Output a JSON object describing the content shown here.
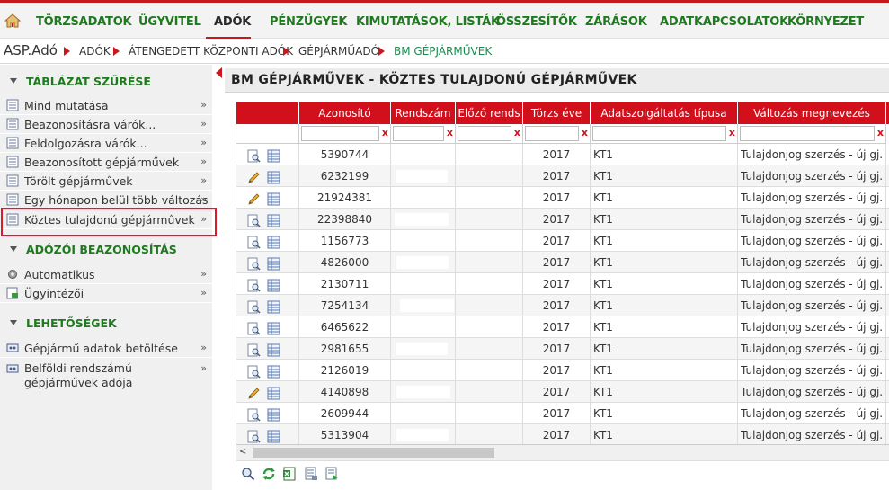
{
  "menu": {
    "home_icon": "home-icon",
    "items": [
      "TÖRZSADATOK",
      "ÜGYVITEL",
      "ADÓK",
      "PÉNZÜGYEK",
      "KIMUTATÁSOK, LISTÁK",
      "ÖSSZESÍTŐK",
      "ZÁRÁSOK",
      "ADATKAPCSOLATOK",
      "KÖRNYEZET"
    ],
    "active": "ADÓK"
  },
  "breadcrumb": [
    "ASP.Adó",
    "Adók",
    "Átengedett központi adók",
    "Gépjárműadó",
    "BM gépjárművek"
  ],
  "sidebar": {
    "filter_title": "TÁBLÁZAT SZŰRÉSE",
    "filter_items": [
      {
        "label": "Mind mutatása"
      },
      {
        "label": "Beazonosításra várók..."
      },
      {
        "label": "Feldolgozásra várók..."
      },
      {
        "label": "Beazonosított gépjárművek"
      },
      {
        "label": "Törölt gépjárművek"
      },
      {
        "label": "Egy hónapon belül több változás"
      },
      {
        "label": "Köztes tulajdonú gépjárművek"
      }
    ],
    "ident_title": "ADÓZÓI BEAZONOSÍTÁS",
    "ident_items": [
      {
        "label": "Automatikus"
      },
      {
        "label": "Ügyintézői"
      }
    ],
    "options_title": "LEHETŐSÉGEK",
    "options_items": [
      {
        "label": "Gépjármű adatok betöltése"
      },
      {
        "label": "Belföldi rendszámú gépjárművek adója"
      }
    ],
    "chevron": "»"
  },
  "main": {
    "title": "BM GÉPJÁRMŰVEK - KÖZTES TULAJDONÚ GÉPJÁRMŰVEK",
    "columns": [
      "Azonosító",
      "Rendszám",
      "Előző rends",
      "Törzs éve",
      "Adatszolgáltatás típusa",
      "Változás megnevezés"
    ],
    "filter_clear": "x",
    "rows": [
      {
        "icon": "view",
        "id": "5390744",
        "year": "2017",
        "type": "KT1",
        "change": "Tulajdonjog szerzés - új gj."
      },
      {
        "icon": "edit",
        "id": "6232199",
        "year": "2017",
        "type": "KT1",
        "change": "Tulajdonjog szerzés - új gj."
      },
      {
        "icon": "edit",
        "id": "21924381",
        "year": "2017",
        "type": "KT1",
        "change": "Tulajdonjog szerzés - új gj."
      },
      {
        "icon": "view",
        "id": "22398840",
        "year": "2017",
        "type": "KT1",
        "change": "Tulajdonjog szerzés - új gj."
      },
      {
        "icon": "view",
        "id": "1156773",
        "year": "2017",
        "type": "KT1",
        "change": "Tulajdonjog szerzés - új gj."
      },
      {
        "icon": "view",
        "id": "4826000",
        "year": "2017",
        "type": "KT1",
        "change": "Tulajdonjog szerzés - új gj."
      },
      {
        "icon": "view",
        "id": "2130711",
        "year": "2017",
        "type": "KT1",
        "change": "Tulajdonjog szerzés - új gj."
      },
      {
        "icon": "view",
        "id": "7254134",
        "year": "2017",
        "type": "KT1",
        "change": "Tulajdonjog szerzés - új gj."
      },
      {
        "icon": "view",
        "id": "6465622",
        "year": "2017",
        "type": "KT1",
        "change": "Tulajdonjog szerzés - új gj."
      },
      {
        "icon": "view",
        "id": "2981655",
        "year": "2017",
        "type": "KT1",
        "change": "Tulajdonjog szerzés - új gj."
      },
      {
        "icon": "view",
        "id": "2126019",
        "year": "2017",
        "type": "KT1",
        "change": "Tulajdonjog szerzés - új gj."
      },
      {
        "icon": "edit",
        "id": "4140898",
        "year": "2017",
        "type": "KT1",
        "change": "Tulajdonjog szerzés - új gj."
      },
      {
        "icon": "view",
        "id": "2609944",
        "year": "2017",
        "type": "KT1",
        "change": "Tulajdonjog szerzés - új gj."
      },
      {
        "icon": "view",
        "id": "5313904",
        "year": "2017",
        "type": "KT1",
        "change": "Tulajdonjog szerzés - új gj."
      }
    ],
    "scroll_left": "<",
    "toolbar_icons": [
      "search-icon",
      "refresh-icon",
      "excel-export-icon",
      "print-list-icon",
      "export-icon"
    ]
  },
  "colors": {
    "brand_red": "#c8181e",
    "header_red": "#d2101c",
    "menu_green": "#1f7a1f",
    "highlight": "#e01a2a"
  }
}
